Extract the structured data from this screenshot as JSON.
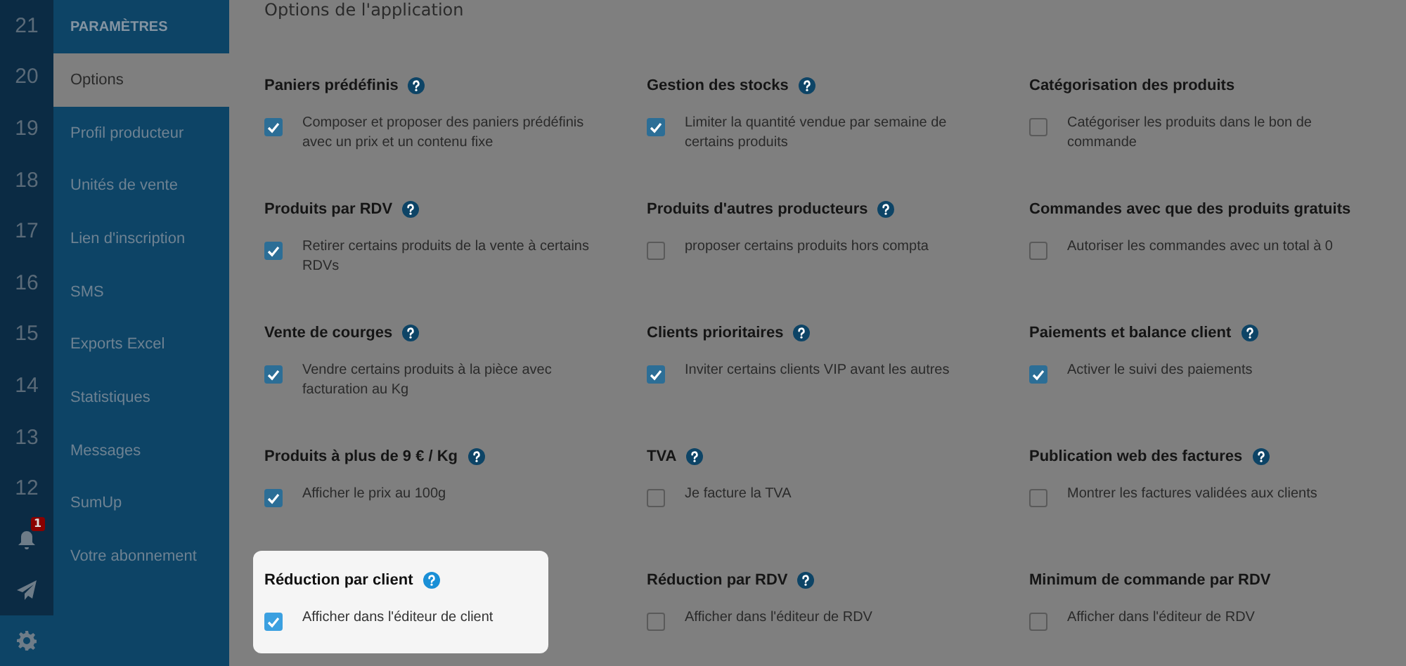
{
  "rail": {
    "numbers": [
      "21",
      "20",
      "19",
      "18",
      "17",
      "16",
      "15",
      "14",
      "13",
      "12"
    ],
    "notification_badge": "1"
  },
  "sidebar": {
    "header": "PARAMÈTRES",
    "items": [
      {
        "label": "Options",
        "selected": true
      },
      {
        "label": "Profil producteur",
        "selected": false
      },
      {
        "label": "Unités de vente",
        "selected": false
      },
      {
        "label": "Lien d'inscription",
        "selected": false
      },
      {
        "label": "SMS",
        "selected": false
      },
      {
        "label": "Exports Excel",
        "selected": false
      },
      {
        "label": "Statistiques",
        "selected": false
      },
      {
        "label": "Messages",
        "selected": false
      },
      {
        "label": "SumUp",
        "selected": false
      },
      {
        "label": "Votre abonnement",
        "selected": false
      }
    ]
  },
  "main": {
    "title": "Options de l'application",
    "options": [
      {
        "title": "Paniers prédéfinis",
        "help": true,
        "checked": true,
        "text": "Composer et proposer des paniers prédéfinis avec un prix et un contenu fixe",
        "highlighted": false
      },
      {
        "title": "Gestion des stocks",
        "help": true,
        "checked": true,
        "text": "Limiter la quantité vendue par semaine de certains produits",
        "highlighted": false
      },
      {
        "title": "Catégorisation des produits",
        "help": false,
        "checked": false,
        "text": "Catégoriser les produits dans le bon de commande",
        "highlighted": false
      },
      {
        "title": "Produits par RDV",
        "help": true,
        "checked": true,
        "text": "Retirer certains produits de la vente à certains RDVs",
        "highlighted": false
      },
      {
        "title": "Produits d'autres producteurs",
        "help": true,
        "checked": false,
        "text": "proposer certains produits hors compta",
        "highlighted": false
      },
      {
        "title": "Commandes avec que des produits gratuits",
        "help": false,
        "checked": false,
        "text": "Autoriser les commandes avec un total à 0",
        "highlighted": false
      },
      {
        "title": "Vente de courges",
        "help": true,
        "checked": true,
        "text": "Vendre certains produits à la pièce avec facturation au Kg",
        "highlighted": false
      },
      {
        "title": "Clients prioritaires",
        "help": true,
        "checked": true,
        "text": "Inviter certains clients VIP avant les autres",
        "highlighted": false
      },
      {
        "title": "Paiements et balance client",
        "help": true,
        "checked": true,
        "text": "Activer le suivi des paiements",
        "highlighted": false
      },
      {
        "title": "Produits à plus de 9 € / Kg",
        "help": true,
        "checked": true,
        "text": "Afficher le prix au 100g",
        "highlighted": false
      },
      {
        "title": "TVA",
        "help": true,
        "checked": false,
        "text": "Je facture la TVA",
        "highlighted": false
      },
      {
        "title": "Publication web des factures",
        "help": true,
        "checked": false,
        "text": "Montrer les factures validées aux clients",
        "highlighted": false
      },
      {
        "title": "Réduction par client",
        "help": true,
        "checked": true,
        "text": "Afficher dans l'éditeur de client",
        "highlighted": true
      },
      {
        "title": "Réduction par RDV",
        "help": true,
        "checked": false,
        "text": "Afficher dans l'éditeur de RDV",
        "highlighted": false
      },
      {
        "title": "Minimum de commande par RDV",
        "help": false,
        "checked": false,
        "text": "Afficher dans l'éditeur de RDV",
        "highlighted": false
      }
    ]
  }
}
